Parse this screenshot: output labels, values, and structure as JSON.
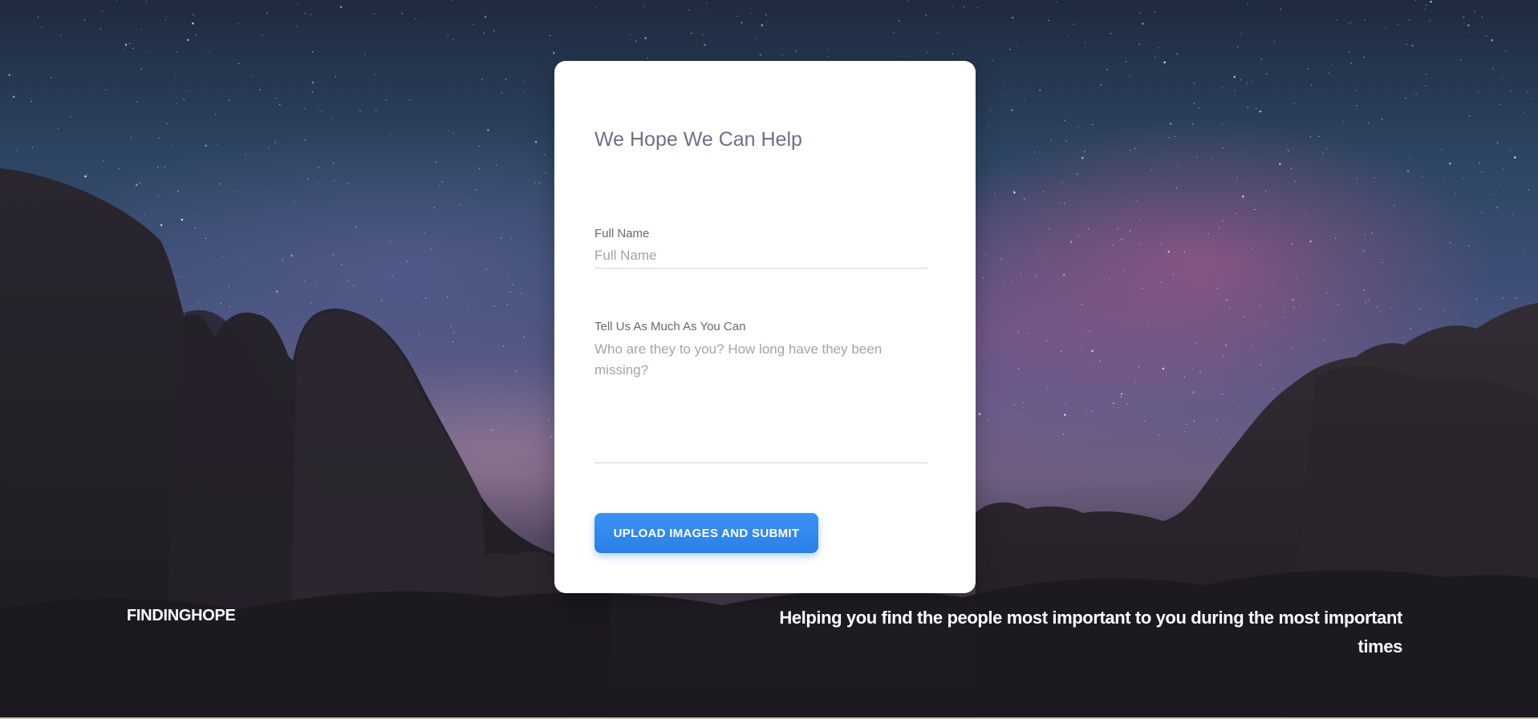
{
  "form": {
    "title": "We Hope We Can Help",
    "name_label": "Full Name",
    "name_placeholder": "Full Name",
    "story_label": "Tell Us As Much As You Can",
    "story_placeholder": "Who are they to you? How long have they been missing?",
    "submit_label": "UPLOAD IMAGES AND SUBMIT"
  },
  "footer": {
    "brand": "FINDINGHOPE",
    "tagline": "Helping you find the people most important to you during the most important times"
  },
  "colors": {
    "accent": "#2a7fe5",
    "title_text": "#6f6f89",
    "card_background": "#ffffff"
  }
}
